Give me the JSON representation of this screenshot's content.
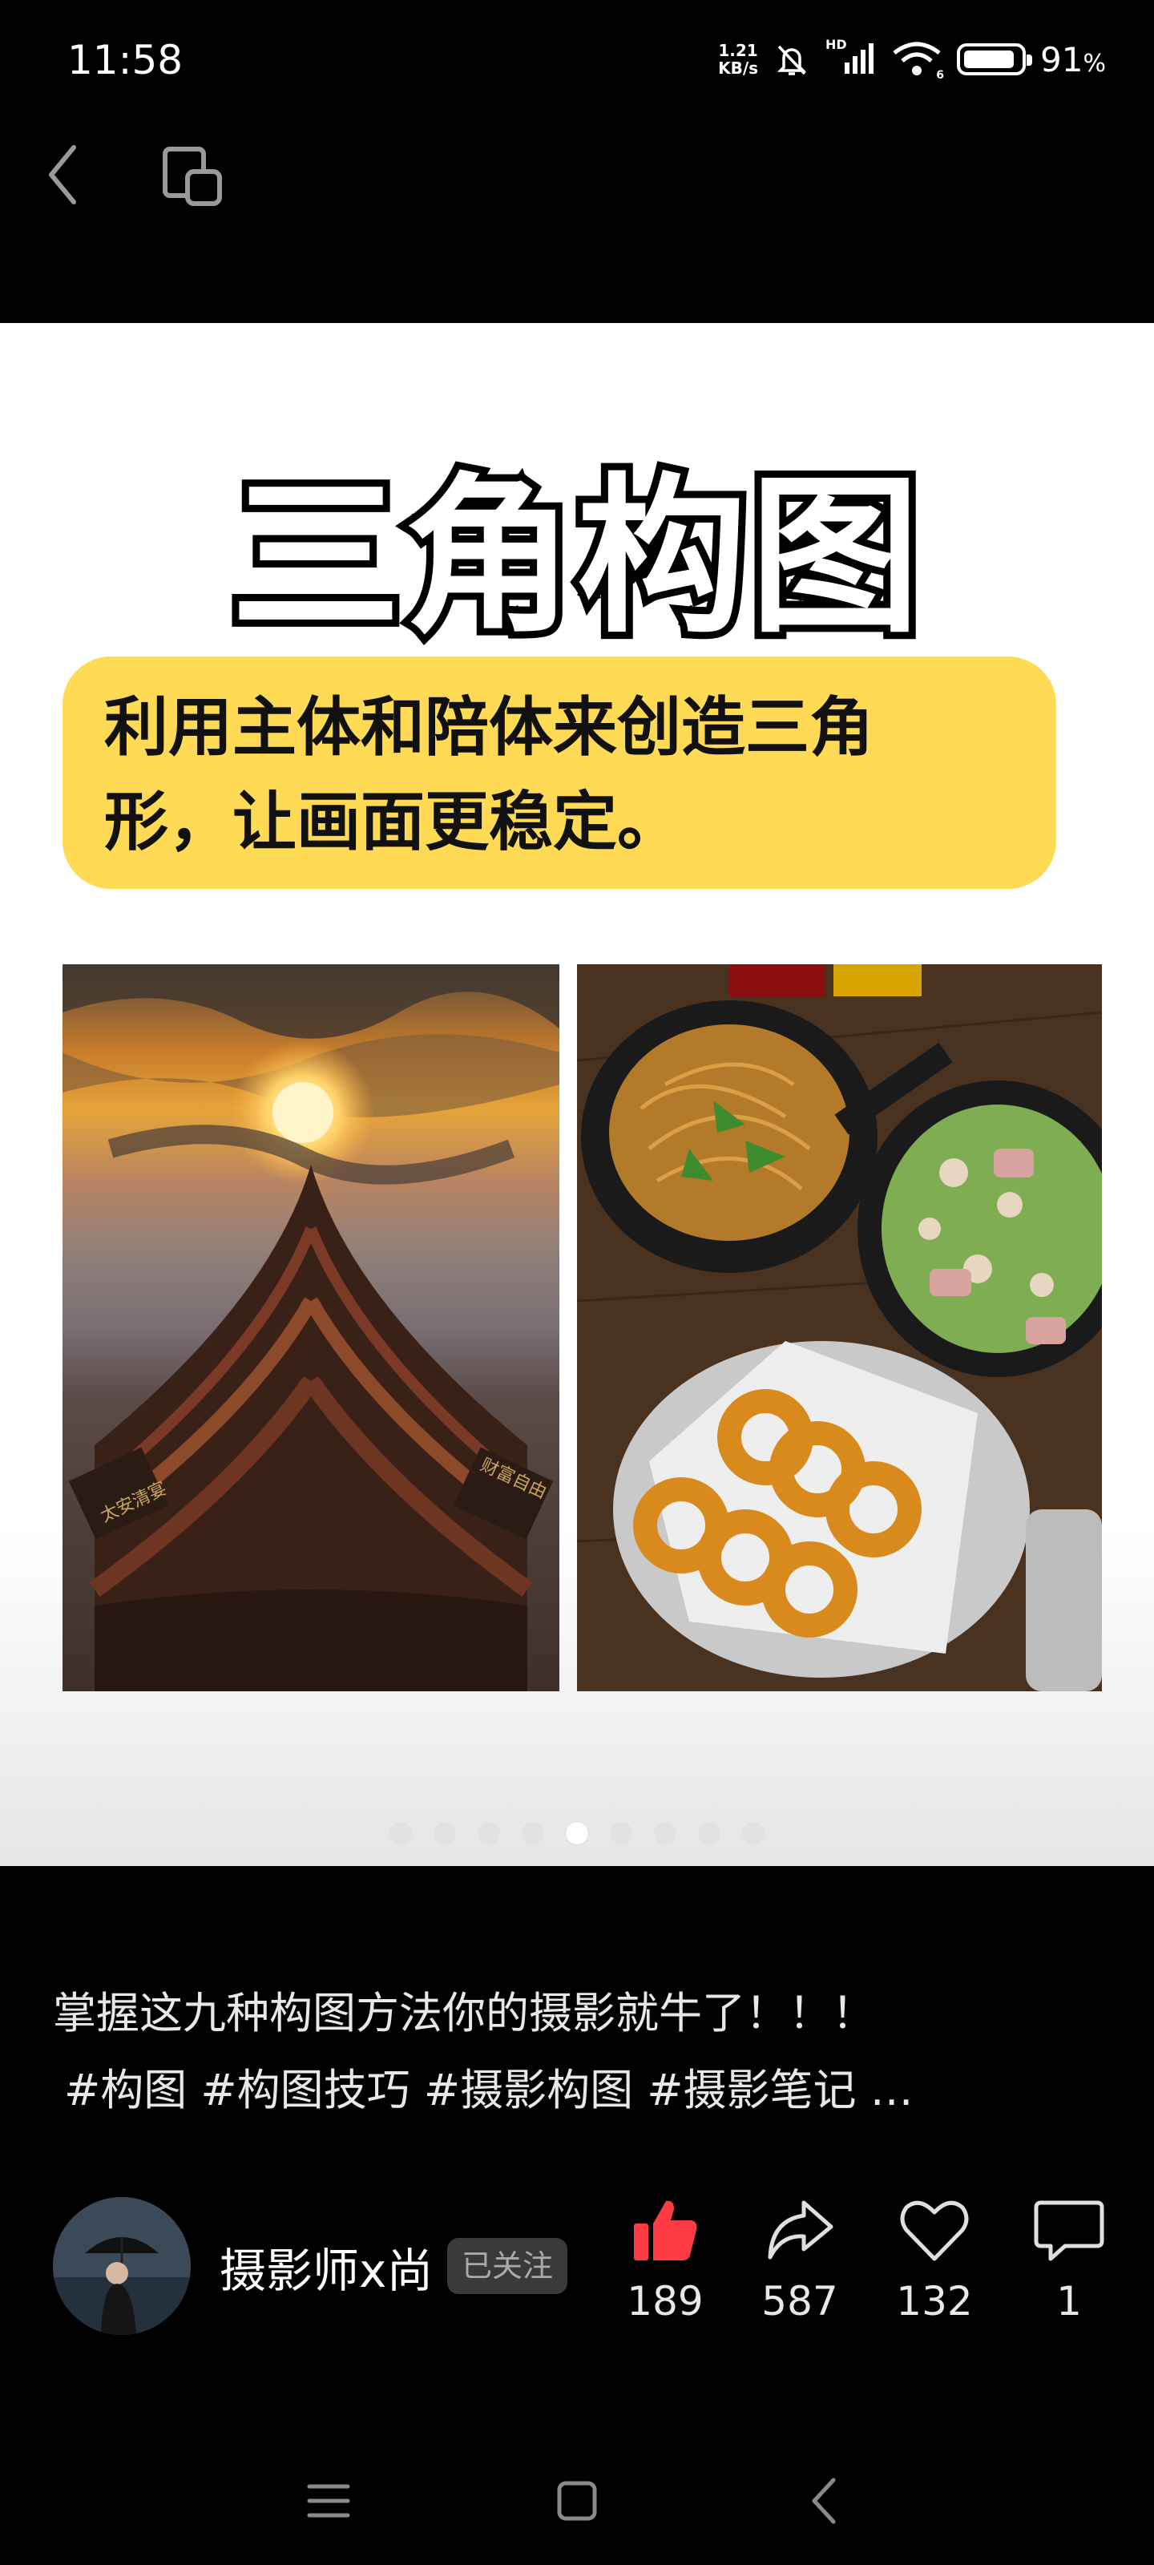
{
  "status_bar": {
    "time": "11:58",
    "net_speed_value": "1.21",
    "net_speed_unit": "KB/s",
    "signal_label": "HD",
    "wifi_badge": "6",
    "battery_percent": 91,
    "battery_text": "91",
    "battery_unit": "%"
  },
  "post": {
    "slide_title": "三角构图",
    "slide_description_line1": "利用主体和陪体来创造三角",
    "slide_description_line2": "形，让画面更稳定。",
    "left_photo_sign_left": "太安清宴",
    "left_photo_sign_right": "财富自由",
    "pager_total": 9,
    "pager_active_index": 4,
    "caption_line1": "掌握这九种构图方法你的摄影就牛了！！！",
    "caption_line2": "#构图 #构图技巧 #摄影构图 #摄影笔记 …"
  },
  "author": {
    "name": "摄影师x尚",
    "follow_status": "已关注"
  },
  "actions": {
    "like_count": "189",
    "share_count": "587",
    "favorite_count": "132",
    "comment_count": "1"
  },
  "icons": {
    "back": "chevron-left-icon",
    "window": "window-switch-icon",
    "like": "thumbs-up-icon",
    "share": "share-arrow-icon",
    "favorite": "heart-icon",
    "comment": "comment-bubble-icon",
    "menu": "menu-icon",
    "home": "home-square-icon",
    "nav_back": "nav-back-icon"
  },
  "colors": {
    "like_red": "#ff3b45",
    "callout_yellow": "#ffdb55"
  }
}
